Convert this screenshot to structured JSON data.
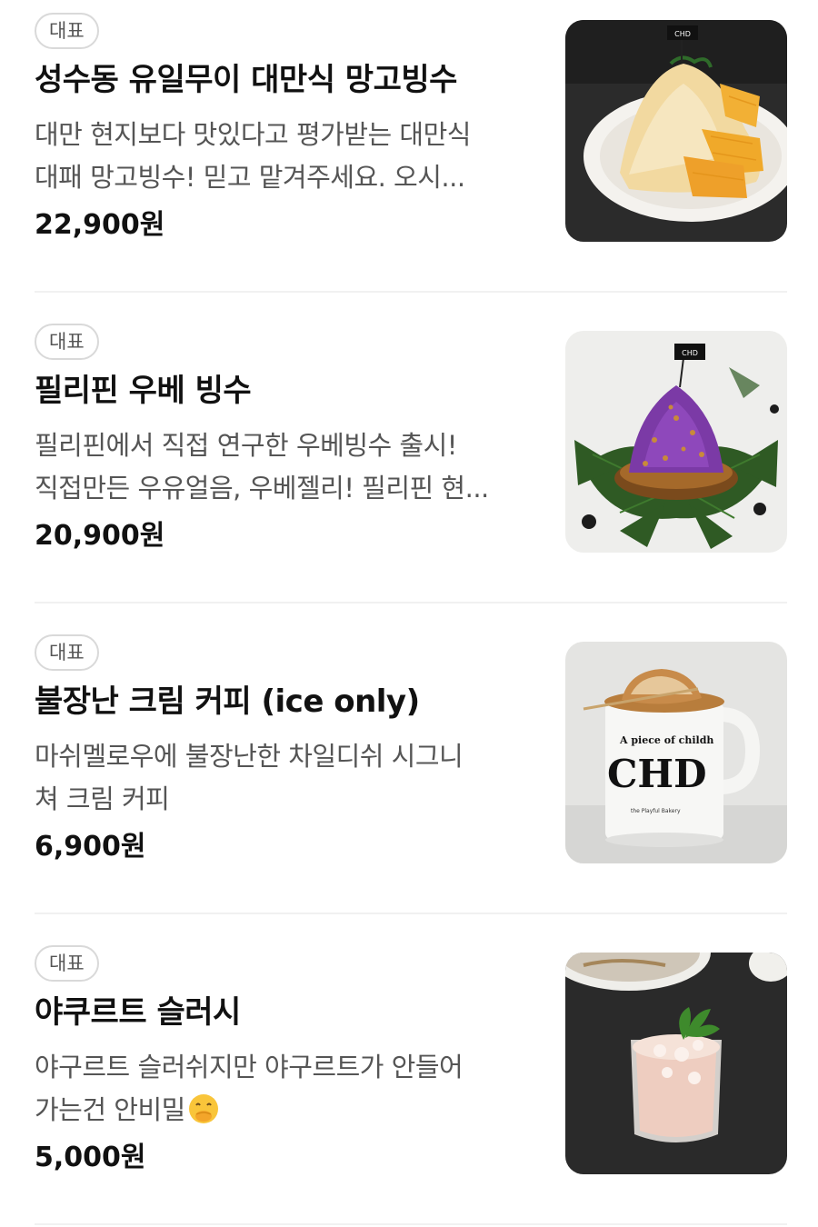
{
  "menu": {
    "items": [
      {
        "badge": "대표",
        "name": "성수동 유일무이 대만식 망고빙수",
        "desc_line1": "대만 현지보다 맛있다고 평가받는 대만식",
        "desc_line2": "대패 망고빙수! 믿고 맡겨주세요. 오시...",
        "price": "22,900원",
        "image_label": "CHD"
      },
      {
        "badge": "대표",
        "name": "필리핀 우베 빙수",
        "desc_line1": "필리핀에서 직접 연구한 우베빙수 출시!",
        "desc_line2": "직접만든 우유얼음, 우베젤리! 필리핀 현...",
        "price": "20,900원",
        "image_label": "CHD"
      },
      {
        "badge": "대표",
        "name": "불장난 크림 커피 (ice only)",
        "desc_line1": "마쉬멜로우에 불장난한 차일디쉬 시그니",
        "desc_line2": "쳐 크림 커피",
        "price": "6,900원",
        "image_label": "CHD",
        "mug_text_top": "A piece of childh",
        "mug_text_bottom": "the Playful Bakery"
      },
      {
        "badge": "대표",
        "name": "야쿠르트 슬러시",
        "desc_line1": "야구르트 슬러쉬지만 야구르트가 안들어",
        "desc_line2": "가는건 안비밀",
        "price": "5,000원",
        "emoji": "face-with-hand-over-mouth-emoji"
      }
    ]
  }
}
